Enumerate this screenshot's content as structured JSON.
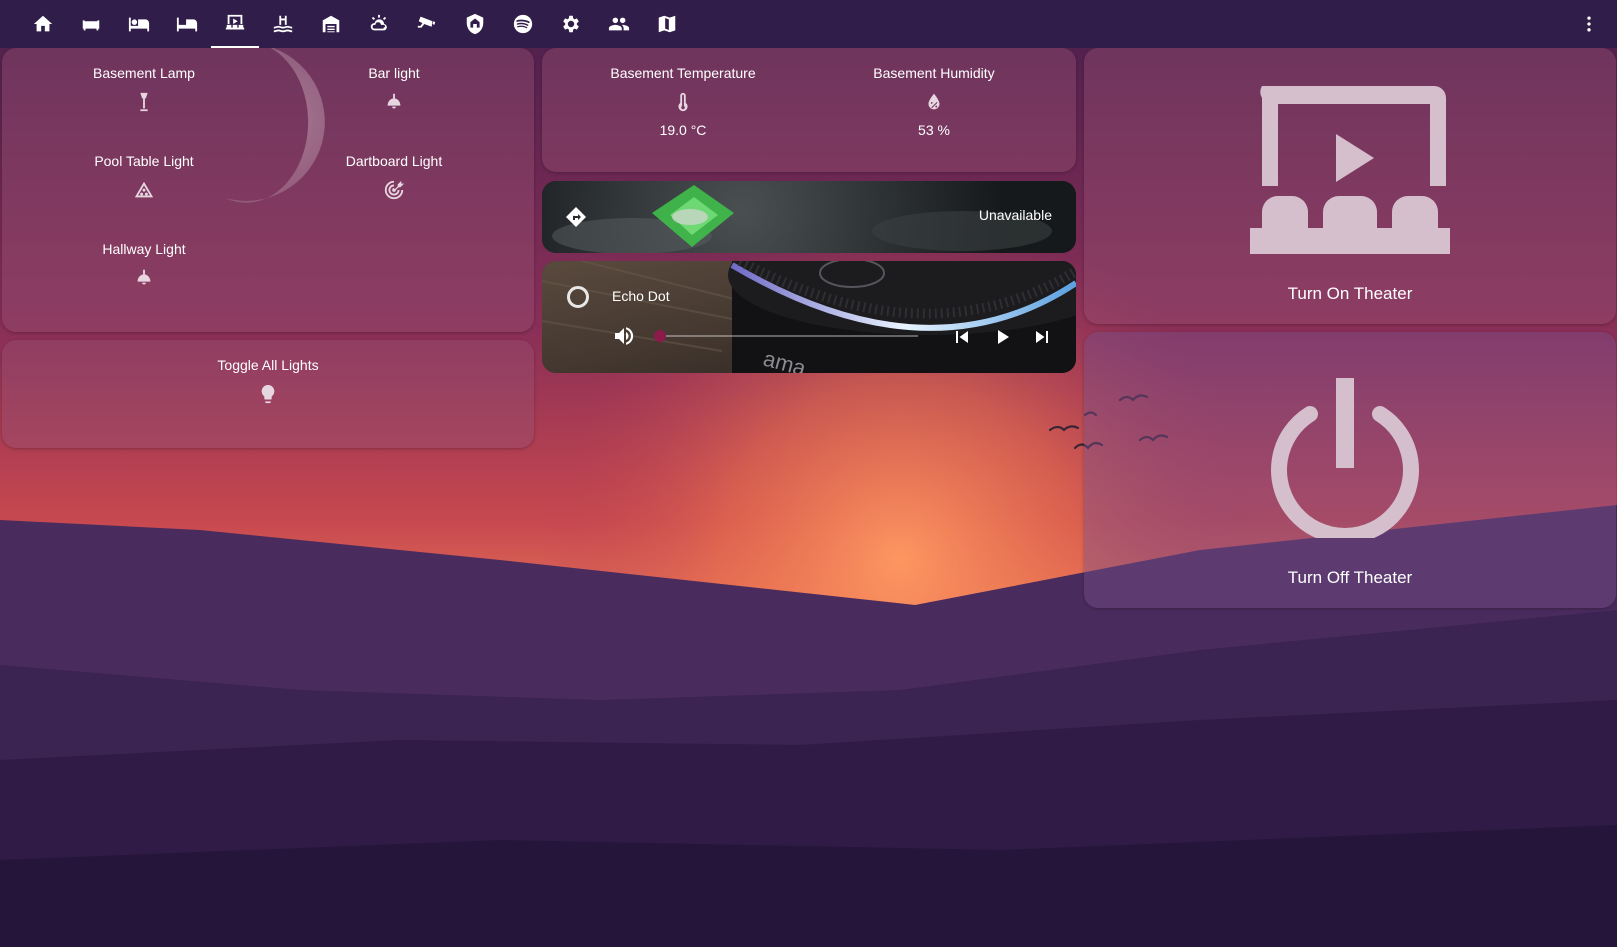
{
  "nav": {
    "items": [
      {
        "icon": "home-icon"
      },
      {
        "icon": "sofa-icon"
      },
      {
        "icon": "bed-icon"
      },
      {
        "icon": "bed-empty-icon"
      },
      {
        "icon": "theater-icon",
        "active": true
      },
      {
        "icon": "pool-icon"
      },
      {
        "icon": "garage-icon"
      },
      {
        "icon": "weather-icon"
      },
      {
        "icon": "cctv-icon"
      },
      {
        "icon": "shield-icon"
      },
      {
        "icon": "spotify-icon"
      },
      {
        "icon": "gear-icon"
      },
      {
        "icon": "people-icon"
      },
      {
        "icon": "map-icon"
      }
    ],
    "menu_icon": "dots-vertical-icon"
  },
  "lights_card": {
    "entities": [
      {
        "name": "Basement Lamp",
        "icon": "floor-lamp-icon"
      },
      {
        "name": "Bar light",
        "icon": "ceiling-light-icon"
      },
      {
        "name": "Pool Table Light",
        "icon": "billiards-icon"
      },
      {
        "name": "Dartboard Light",
        "icon": "bullseye-icon"
      },
      {
        "name": "Hallway Light",
        "icon": "ceiling-light-icon"
      }
    ]
  },
  "toggle_card": {
    "name": "Toggle All Lights",
    "icon": "lightbulb-icon"
  },
  "sensors_card": {
    "temperature": {
      "name": "Basement Temperature",
      "value": "19.0 °C",
      "icon": "thermometer-icon"
    },
    "humidity": {
      "name": "Basement Humidity",
      "value": "53 %",
      "icon": "water-percent-icon"
    }
  },
  "weather_media": {
    "status": "Unavailable",
    "icon": "cast-icon"
  },
  "echo_media": {
    "name": "Echo Dot",
    "progress": 0.0,
    "icon": "alexa-ring-icon"
  },
  "theater_on": {
    "label": "Turn On Theater",
    "icon": "theater-icon"
  },
  "theater_off": {
    "label": "Turn Off Theater",
    "icon": "power-icon"
  },
  "colors": {
    "accent": "#f08a5a",
    "card": "#965073",
    "bar": "#311d49",
    "seek_dot": "#8c1a4a"
  }
}
